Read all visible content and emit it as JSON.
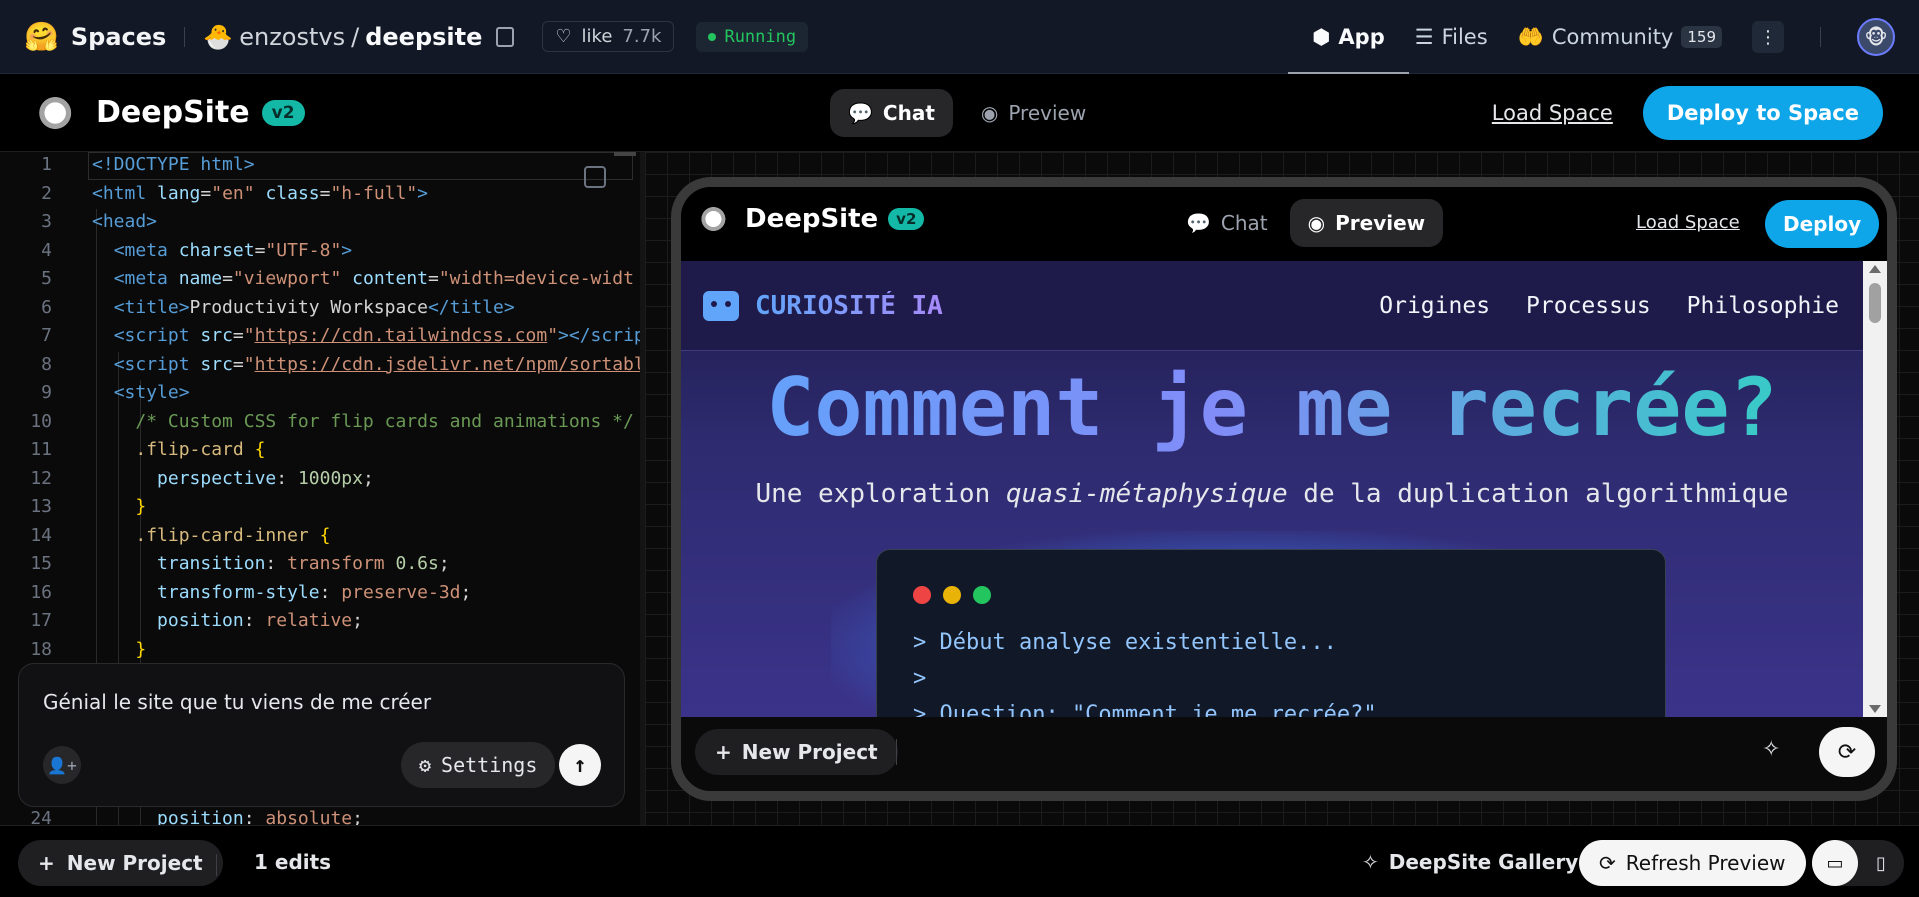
{
  "hf": {
    "logo": "🤗",
    "spaces": "Spaces",
    "owner_icon": "🐣",
    "owner": "enzostvs",
    "slash": "/",
    "repo": "deepsite",
    "like_label": "like",
    "like_count": "7.7k",
    "status": "Running",
    "tabs": [
      {
        "label": "App",
        "icon": "⬢"
      },
      {
        "label": "Files",
        "icon": "☰"
      },
      {
        "label": "Community",
        "icon": "🤲",
        "count": "159"
      }
    ],
    "avatar": "🐵"
  },
  "ds": {
    "title": "DeepSite",
    "version": "v2",
    "chat_label": "Chat",
    "preview_label": "Preview",
    "load_space": "Load Space",
    "deploy_to_space": "Deploy to Space"
  },
  "editor": {
    "line_numbers": [
      "1",
      "2",
      "3",
      "4",
      "5",
      "6",
      "7",
      "8",
      "9",
      "10",
      "11",
      "12",
      "13",
      "14",
      "15",
      "16",
      "17",
      "18"
    ],
    "last_line_number": "24",
    "last_line_prop": "position",
    "last_line_value": "absolute"
  },
  "chat": {
    "input_value": "Génial le site que tu viens de me créer",
    "settings_label": "Settings"
  },
  "preview": {
    "title": "DeepSite",
    "version": "v2",
    "chat_label": "Chat",
    "preview_label": "Preview",
    "load_space": "Load Space",
    "deploy": "Deploy",
    "site": {
      "brand": "CURIOSITÉ IA",
      "nav": [
        "Origines",
        "Processus",
        "Philosophie"
      ],
      "hero_title": "Comment je me recrée?",
      "sub_pre": "Une exploration ",
      "sub_em": "quasi-métaphysique",
      "sub_post": " de la duplication algorithmique",
      "terminal_lines": [
        "> Début analyse existentielle...",
        ">",
        "> Question: \"Comment je me recrée?\""
      ]
    },
    "new_project": "New Project"
  },
  "bottom": {
    "new_project": "New Project",
    "edits": "1 edits",
    "gallery": "DeepSite Gallery",
    "refresh": "Refresh Preview"
  },
  "colors": {
    "accent": "#0ea5e9",
    "version_badge": "#14b8a6",
    "running": "#22c55e",
    "terminal_red": "#ef4444",
    "terminal_yellow": "#eab308",
    "terminal_green": "#22c55e"
  }
}
